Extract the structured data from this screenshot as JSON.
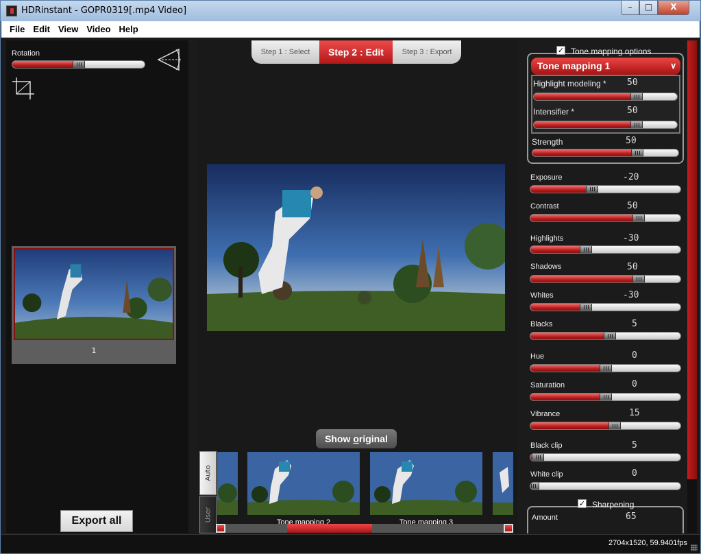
{
  "window": {
    "app_name": "HDRinstant",
    "separator": " - ",
    "file_name": "GOPR0319[.mp4 Video]",
    "min_glyph": "–",
    "max_glyph": "□",
    "close_glyph": "X"
  },
  "menu": [
    "File",
    "Edit",
    "View",
    "Video",
    "Help"
  ],
  "left": {
    "rotation_label": "Rotation",
    "rotation_value": 0.5,
    "thumbnail_index": "1",
    "export_all_label": "Export all"
  },
  "steps": [
    {
      "label": "Step 1 : Select",
      "active": false
    },
    {
      "label": "Step 2 : Edit",
      "active": true
    },
    {
      "label": "Step 3 : Export",
      "active": false
    }
  ],
  "preview": {
    "show_original_pre": "Show ",
    "show_original_underlined": "o",
    "show_original_post": "riginal"
  },
  "strip": {
    "tabs": [
      "Auto",
      "User"
    ],
    "items": [
      "Tone mapping 2",
      "Tone mapping 3"
    ]
  },
  "tone_mapping": {
    "section_label": "Tone mapping options",
    "checked": true,
    "preset": "Tone mapping 1",
    "sliders": [
      {
        "label": "Highlight modeling *",
        "value": "50",
        "fraction": 0.72
      },
      {
        "label": "Intensifier *",
        "value": "50",
        "fraction": 0.72
      },
      {
        "label": "Strength",
        "value": "50",
        "fraction": 0.72
      }
    ]
  },
  "adjustments": [
    {
      "label": "Exposure",
      "value": "-20",
      "fraction": 0.41
    },
    {
      "label": "Contrast",
      "value": "50",
      "fraction": 0.72
    },
    {
      "label": "Highlights",
      "value": "-30",
      "fraction": 0.37
    },
    {
      "label": "Shadows",
      "value": "50",
      "fraction": 0.72
    },
    {
      "label": "Whites",
      "value": "-30",
      "fraction": 0.37
    },
    {
      "label": "Blacks",
      "value": "5",
      "fraction": 0.53
    },
    {
      "label": "Hue",
      "value": "0",
      "fraction": 0.5
    },
    {
      "label": "Saturation",
      "value": "0",
      "fraction": 0.5
    },
    {
      "label": "Vibrance",
      "value": "15",
      "fraction": 0.56
    },
    {
      "label": "Black clip",
      "value": "5",
      "fraction": 0.05
    },
    {
      "label": "White clip",
      "value": "0",
      "fraction": 0.02
    }
  ],
  "sharpening": {
    "section_label": "Sharpening",
    "checked": true,
    "amount_label": "Amount",
    "amount_value": "65"
  },
  "status": {
    "resolution": "2704x1520, 59.9401fps"
  },
  "colors": {
    "accent": "#b71c1c",
    "background": "#1b1b1b"
  },
  "icons": [
    "app-icon",
    "level-horizon-icon",
    "crop-icon",
    "checkbox-icon",
    "chevron-down-icon",
    "resize-grip-icon"
  ]
}
